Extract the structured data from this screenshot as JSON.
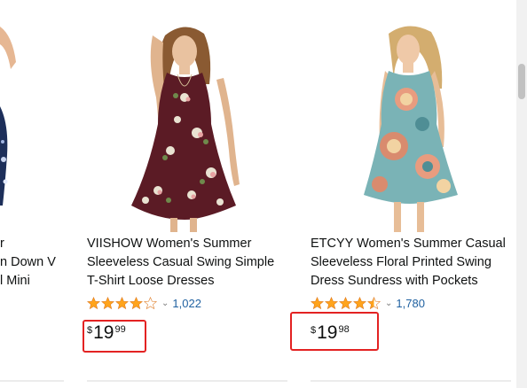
{
  "products": [
    {
      "title_lines": [
        "r",
        "n Down V",
        "l Mini"
      ]
    },
    {
      "title_lines": [
        "VIISHOW Women's Summer",
        "Sleeveless Casual Swing Simple",
        "T-Shirt Loose Dresses"
      ],
      "rating": 4.0,
      "review_count": "1,022",
      "price": {
        "symbol": "$",
        "whole": "19",
        "fraction": "99"
      }
    },
    {
      "title_lines": [
        "ETCYY Women's Summer Casual",
        "Sleeveless Floral Printed Swing",
        "Dress Sundress with Pockets"
      ],
      "rating": 4.5,
      "review_count": "1,780",
      "price": {
        "symbol": "$",
        "whole": "19",
        "fraction": "98"
      }
    }
  ],
  "icons": {
    "chevron": "⌄",
    "star": "star-icon"
  },
  "colors": {
    "highlight": "#e32222",
    "star_fill": "#ffa41c",
    "link": "#2162a1"
  }
}
